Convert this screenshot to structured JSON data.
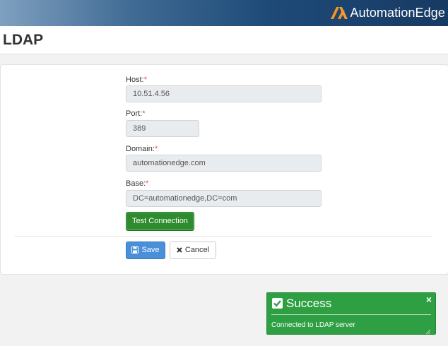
{
  "header": {
    "brand": "AutomationEdge"
  },
  "page": {
    "title": "LDAP"
  },
  "form": {
    "host": {
      "label": "Host:",
      "required": "*",
      "value": "10.51.4.56"
    },
    "port": {
      "label": "Port:",
      "required": "*",
      "value": "389"
    },
    "domain": {
      "label": "Domain:",
      "required": "*",
      "value": "automationedge.com"
    },
    "base": {
      "label": "Base:",
      "required": "*",
      "value": "DC=automationedge,DC=com"
    },
    "test_button": "Test Connection",
    "save_button": "Save",
    "cancel_button": "Cancel"
  },
  "toast": {
    "title": "Success",
    "message": "Connected to LDAP server",
    "close": "×",
    "icons": {
      "status": "check-square-icon",
      "close": "close-icon"
    }
  },
  "colors": {
    "header_dark": "#173a63",
    "brand_accent": "#f7941d",
    "test_button": "#2e8b2e",
    "save_button": "#4a90d9",
    "toast_bg": "#2ea043",
    "required": "#d9534f"
  }
}
